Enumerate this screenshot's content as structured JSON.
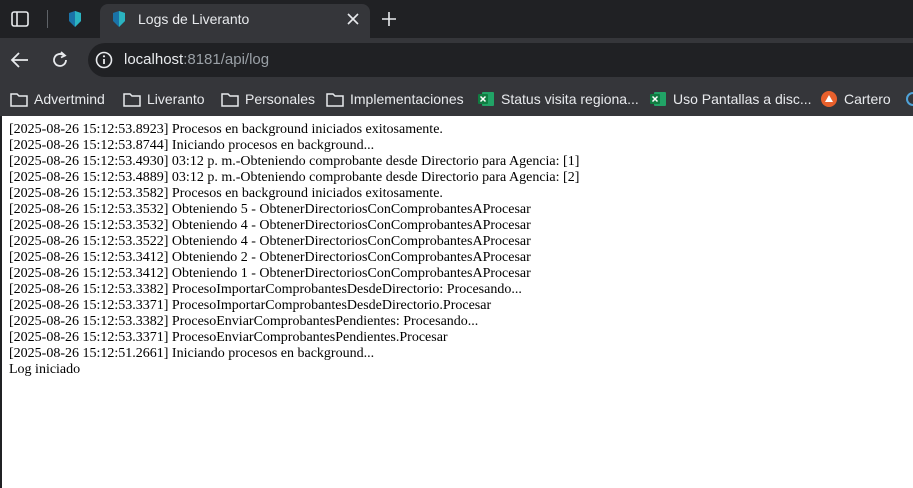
{
  "tabs": {
    "active_title": "Logs de Liveranto"
  },
  "address": {
    "host": "localhost",
    "path": ":8181/api/log"
  },
  "bookmarks": [
    {
      "label": "Advertmind",
      "icon": "folder-icon"
    },
    {
      "label": "Liveranto",
      "icon": "folder-icon"
    },
    {
      "label": "Personales",
      "icon": "folder-icon"
    },
    {
      "label": "Implementaciones",
      "icon": "folder-icon"
    },
    {
      "label": "Status visita regiona...",
      "icon": "excel-icon"
    },
    {
      "label": "Uso Pantallas a disc...",
      "icon": "excel-icon"
    },
    {
      "label": "Cartero",
      "icon": "cartero-icon"
    }
  ],
  "log": {
    "lines": [
      "[2025-08-26 15:12:53.8923] Procesos en background iniciados exitosamente.",
      "[2025-08-26 15:12:53.8744] Iniciando procesos en background...",
      "[2025-08-26 15:12:53.4930] 03:12 p. m.-Obteniendo comprobante desde Directorio para Agencia: [1]",
      "[2025-08-26 15:12:53.4889] 03:12 p. m.-Obteniendo comprobante desde Directorio para Agencia: [2]",
      "[2025-08-26 15:12:53.3582] Procesos en background iniciados exitosamente.",
      "[2025-08-26 15:12:53.3532] Obteniendo 5 - ObtenerDirectoriosConComprobantesAProcesar",
      "[2025-08-26 15:12:53.3532] Obteniendo 4 - ObtenerDirectoriosConComprobantesAProcesar",
      "[2025-08-26 15:12:53.3522] Obteniendo 4 - ObtenerDirectoriosConComprobantesAProcesar",
      "[2025-08-26 15:12:53.3412] Obteniendo 2 - ObtenerDirectoriosConComprobantesAProcesar",
      "[2025-08-26 15:12:53.3412] Obteniendo 1 - ObtenerDirectoriosConComprobantesAProcesar",
      "[2025-08-26 15:12:53.3382] ProcesoImportarComprobantesDesdeDirectorio: Procesando...",
      "[2025-08-26 15:12:53.3371] ProcesoImportarComprobantesDesdeDirectorio.Procesar",
      "[2025-08-26 15:12:53.3382] ProcesoEnviarComprobantesPendientes: Procesando...",
      "[2025-08-26 15:12:53.3371] ProcesoEnviarComprobantesPendientes.Procesar",
      "[2025-08-26 15:12:51.2661] Iniciando procesos en background...",
      "Log iniciado"
    ]
  }
}
